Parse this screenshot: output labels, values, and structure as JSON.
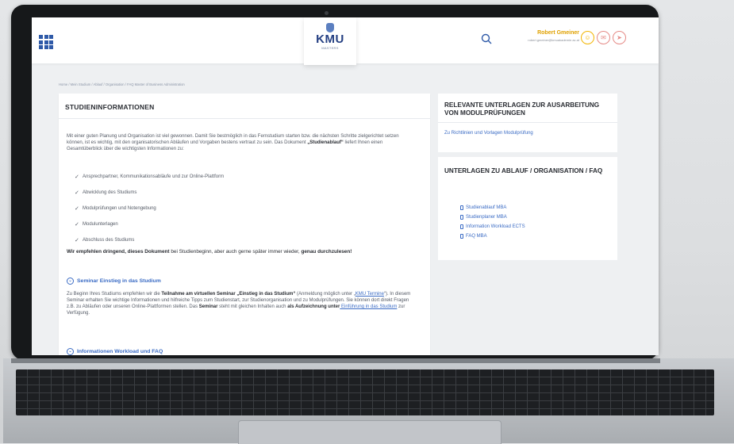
{
  "header": {
    "logo_text": "KMU",
    "logo_sub": "MASTERS",
    "user_name": "Robert Gmeiner",
    "user_email": "robert.gmeiner@kmuakademie.ac.at"
  },
  "breadcrumb": "Home / Mein Studium / Ablauf / Organisation / FAQ Master of Business Administration",
  "main": {
    "title": "STUDIENINFORMATIONEN",
    "intro_1": "Mit einer guten Planung und Organisation ist viel gewonnen. Damit Sie bestmöglich in das Fernstudium starten bzw. die nächsten Schritte zielgerichtet setzen können, ist es wichtig, mit den organisatorischen Abläufen und Vorgaben bestens vertraut zu sein. Das Dokument ",
    "intro_bold": "„Studienablauf“",
    "intro_2": " liefert Ihnen einen Gesamtüberblick über die wichtigsten Informationen zu:",
    "checks": [
      "Ansprechpartner, Kommunikationsabläufe und zur Online-Plattform",
      "Abwicklung des Studiums",
      "Modulprüfungen und Notengebung",
      "Modulunterlagen",
      "Abschluss des Studiums"
    ],
    "recommend_bold": "Wir empfehlen dringend, dieses Dokument",
    "recommend_mid": " bei Studienbeginn, aber auch gerne später immer wieder, ",
    "recommend_bold2": "genau durchzulesen!",
    "seminar_title": "Seminar Einstieg in das Studium",
    "seminar_1": "Zu Beginn Ihres Studiums empfehlen wir die ",
    "seminar_bold1": "Teilnahme am virtuellen Seminar „Einstieg in das Studium“",
    "seminar_2": " (Anmeldung möglich unter „",
    "seminar_link1": "KMU Termine",
    "seminar_3": "“). In diesem Seminar erhalten Sie wichtige Informationen und hilfreiche Tipps zum Studienstart, zur Studienorganisation und zu Modulprüfungen. Sie können dort direkt Fragen z.B. zu Abläufen oder unseren Online-Plattformen stellen. Das ",
    "seminar_bold2": "Seminar",
    "seminar_4": " steht mit gleichen Inhalten auch ",
    "seminar_bold3": "als Aufzeichnung unter",
    "seminar_link2": " Einführung in das Studium",
    "seminar_5": " zur Verfügung.",
    "workload_title": "Informationen Workload und FAQ"
  },
  "side1": {
    "title": "RELEVANTE UNTERLAGEN ZUR AUSARBEITUNG VON MODULPRÜFUNGEN",
    "link": "Zu Richtlinien und Vorlagen Modulprüfung"
  },
  "side2": {
    "title": "UNTERLAGEN ZU ABLAUF / ORGANISATION / FAQ",
    "docs": [
      "Studienablauf MBA",
      "Studienplaner MBA",
      "Information Workload ECTS",
      "FAQ MBA"
    ]
  }
}
